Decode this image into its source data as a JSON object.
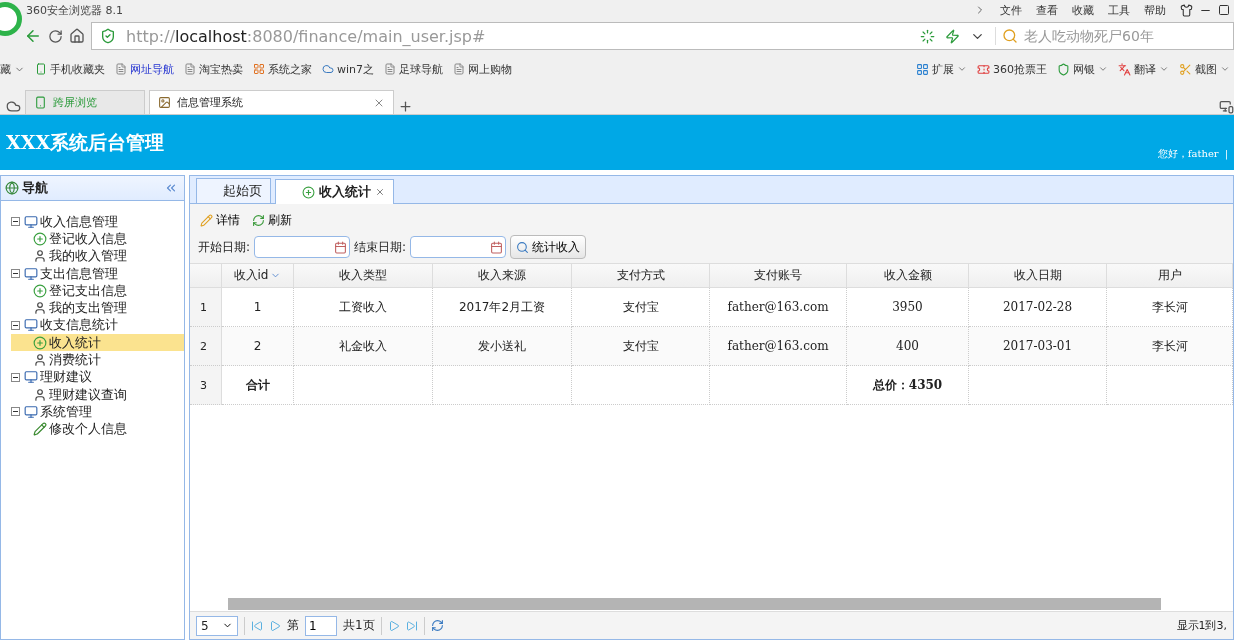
{
  "browser": {
    "title": "360安全浏览器 8.1",
    "menu": [
      "文件",
      "查看",
      "收藏",
      "工具",
      "帮助"
    ],
    "url": {
      "scheme": "http://",
      "host": "localhost",
      "rest": ":8080/finance/main_user.jsp#"
    },
    "search": {
      "placeholder": "老人吃动物死尸60年"
    },
    "bookmarks": [
      {
        "label": "藏",
        "kind": "dropdown"
      },
      {
        "label": "手机收藏夹",
        "kind": "phone"
      },
      {
        "label": "网址导航",
        "kind": "link"
      },
      {
        "label": "淘宝热卖",
        "kind": "page"
      },
      {
        "label": "系统之家",
        "kind": "windows"
      },
      {
        "label": "win7之",
        "kind": "cloud"
      },
      {
        "label": "足球导航",
        "kind": "page"
      },
      {
        "label": "网上购物",
        "kind": "page"
      }
    ],
    "extensions": [
      {
        "label": "扩展",
        "kind": "grid"
      },
      {
        "label": "360抢票王",
        "kind": "ticket"
      },
      {
        "label": "网银",
        "kind": "shield"
      },
      {
        "label": "翻译",
        "kind": "translate"
      },
      {
        "label": "截图",
        "kind": "scissors"
      }
    ],
    "tabs": [
      {
        "label": "跨屏浏览",
        "kind": "sync",
        "selected": false
      },
      {
        "label": "信息管理系统",
        "kind": "page",
        "selected": true
      }
    ]
  },
  "app": {
    "title": "XXX系统后台管理",
    "greeting": "您好，father",
    "separator": "|"
  },
  "nav": {
    "title": "导航",
    "tree": [
      {
        "label": "收入信息管理",
        "kind": "folder",
        "expanded": true,
        "selected": false,
        "children": [
          {
            "label": "登记收入信息",
            "kind": "add",
            "selected": false
          },
          {
            "label": "我的收入管理",
            "kind": "user",
            "selected": false
          }
        ]
      },
      {
        "label": "支出信息管理",
        "kind": "folder",
        "expanded": true,
        "selected": false,
        "children": [
          {
            "label": "登记支出信息",
            "kind": "add",
            "selected": false
          },
          {
            "label": "我的支出管理",
            "kind": "user",
            "selected": false
          }
        ]
      },
      {
        "label": "收支信息统计",
        "kind": "folder",
        "expanded": true,
        "selected": false,
        "children": [
          {
            "label": "收入统计",
            "kind": "add",
            "selected": true
          },
          {
            "label": "消费统计",
            "kind": "user",
            "selected": false
          }
        ]
      },
      {
        "label": "理财建议",
        "kind": "folder",
        "expanded": true,
        "selected": false,
        "children": [
          {
            "label": "理财建议查询",
            "kind": "user",
            "selected": false
          }
        ]
      },
      {
        "label": "系统管理",
        "kind": "folder",
        "expanded": true,
        "selected": false,
        "children": [
          {
            "label": "修改个人信息",
            "kind": "edit",
            "selected": false
          }
        ]
      }
    ]
  },
  "content_tabs": [
    {
      "label": "起始页",
      "selected": false,
      "closable": false
    },
    {
      "label": "收入统计",
      "selected": true,
      "closable": true
    }
  ],
  "toolbar": [
    {
      "label": "详情",
      "kind": "edit"
    },
    {
      "label": "刷新",
      "kind": "refresh"
    }
  ],
  "filter": {
    "start_label": "开始日期:",
    "end_label": "结束日期:",
    "button": "统计收入"
  },
  "table": {
    "columns": [
      {
        "label": "收入id",
        "sorted": true
      },
      {
        "label": "收入类型",
        "sorted": false
      },
      {
        "label": "收入来源",
        "sorted": false
      },
      {
        "label": "支付方式",
        "sorted": false
      },
      {
        "label": "支付账号",
        "sorted": false
      },
      {
        "label": "收入金额",
        "sorted": false
      },
      {
        "label": "收入日期",
        "sorted": false
      },
      {
        "label": "用户",
        "sorted": false
      }
    ],
    "rows": [
      {
        "number": "1",
        "kind": "data",
        "cells": [
          "1",
          "工资收入",
          "2017年2月工资",
          "支付宝",
          "father@163.com",
          "3950",
          "2017-02-28",
          "李长河"
        ]
      },
      {
        "number": "2",
        "kind": "data",
        "cells": [
          "2",
          "礼金收入",
          "发小送礼",
          "支付宝",
          "father@163.com",
          "400",
          "2017-03-01",
          "李长河"
        ]
      },
      {
        "number": "3",
        "kind": "total",
        "cells": [
          "合计",
          "",
          "",
          "",
          "",
          "总价：4350",
          "",
          ""
        ]
      }
    ]
  },
  "pager": {
    "page_size": "5",
    "page_prefix": "第",
    "page": "1",
    "total_pages": "共1页",
    "summary": "显示1到3,"
  }
}
